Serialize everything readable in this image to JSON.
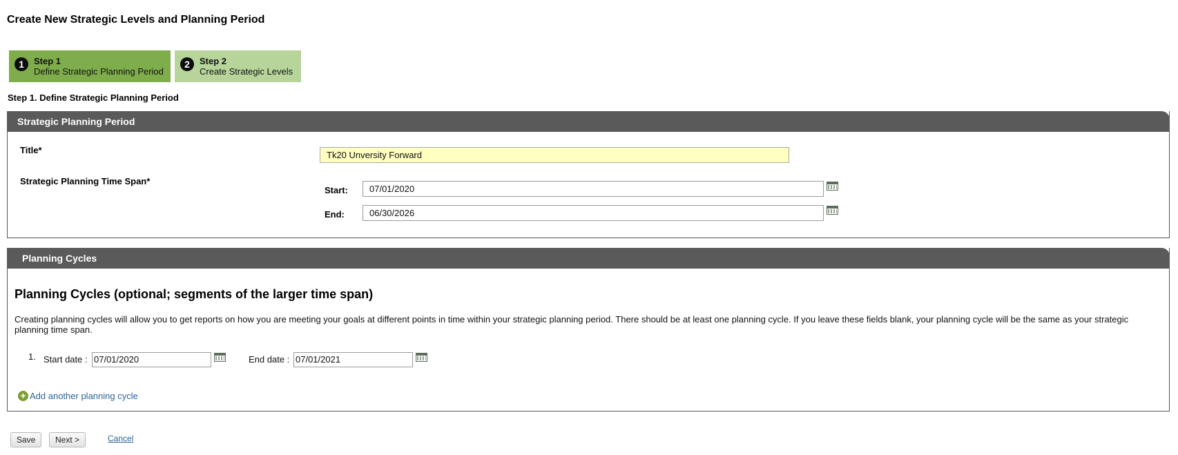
{
  "page": {
    "title": "Create New Strategic Levels and Planning Period"
  },
  "steps": [
    {
      "number": "1",
      "title": "Step 1",
      "subtitle": "Define Strategic Planning Period"
    },
    {
      "number": "2",
      "title": "Step 2",
      "subtitle": "Create Strategic Levels"
    }
  ],
  "section_heading": "Step 1. Define Strategic Planning Period",
  "period_panel": {
    "header": "Strategic Planning Period",
    "title_label": "Title*",
    "title_value": "Tk20 Unversity Forward",
    "timespan_label": "Strategic Planning Time Span*",
    "start_label": "Start:",
    "start_value": "07/01/2020",
    "end_label": "End:",
    "end_value": "06/30/2026"
  },
  "cycles_panel": {
    "header": "Planning Cycles",
    "title": "Planning Cycles (optional; segments of the larger time span)",
    "description": "Creating planning cycles will allow you to get reports on how you are meeting your goals at different points in time within your strategic planning period. There should be at least one planning cycle. If you leave these fields blank, your planning cycle will be the same as your strategic planning time span.",
    "cycles": [
      {
        "index": "1.",
        "start_label": "Start date :",
        "start_value": "07/01/2020",
        "end_label": "End date :",
        "end_value": "07/01/2021"
      }
    ],
    "add_link": "Add another planning cycle"
  },
  "actions": {
    "save": "Save",
    "next": "Next >",
    "cancel": "Cancel"
  }
}
